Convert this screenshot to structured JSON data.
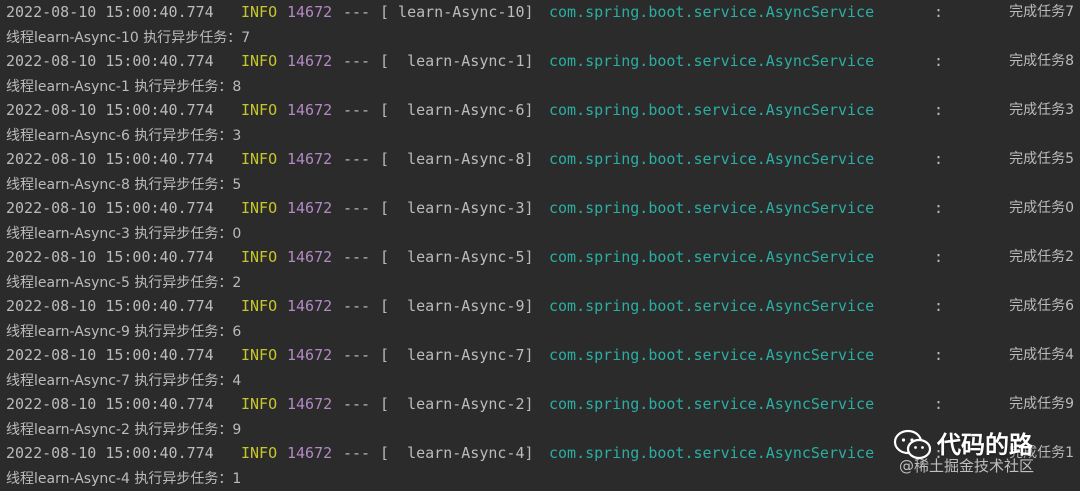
{
  "console": {
    "entries": [
      {
        "timestamp": "2022-08-10 15:00:40.774",
        "level": "INFO",
        "pid": "14672",
        "sep": "---",
        "thread": "[ learn-Async-10]",
        "logger": "com.spring.boot.service.AsyncService",
        "colon": ":",
        "message": "完成任务7",
        "output": "线程learn-Async-10 执行异步任务：7"
      },
      {
        "timestamp": "2022-08-10 15:00:40.774",
        "level": "INFO",
        "pid": "14672",
        "sep": "---",
        "thread": "[  learn-Async-1]",
        "logger": "com.spring.boot.service.AsyncService",
        "colon": ":",
        "message": "完成任务8",
        "output": "线程learn-Async-1 执行异步任务：8"
      },
      {
        "timestamp": "2022-08-10 15:00:40.774",
        "level": "INFO",
        "pid": "14672",
        "sep": "---",
        "thread": "[  learn-Async-6]",
        "logger": "com.spring.boot.service.AsyncService",
        "colon": ":",
        "message": "完成任务3",
        "output": "线程learn-Async-6 执行异步任务：3"
      },
      {
        "timestamp": "2022-08-10 15:00:40.774",
        "level": "INFO",
        "pid": "14672",
        "sep": "---",
        "thread": "[  learn-Async-8]",
        "logger": "com.spring.boot.service.AsyncService",
        "colon": ":",
        "message": "完成任务5",
        "output": "线程learn-Async-8 执行异步任务：5"
      },
      {
        "timestamp": "2022-08-10 15:00:40.774",
        "level": "INFO",
        "pid": "14672",
        "sep": "---",
        "thread": "[  learn-Async-3]",
        "logger": "com.spring.boot.service.AsyncService",
        "colon": ":",
        "message": "完成任务0",
        "output": "线程learn-Async-3 执行异步任务：0"
      },
      {
        "timestamp": "2022-08-10 15:00:40.774",
        "level": "INFO",
        "pid": "14672",
        "sep": "---",
        "thread": "[  learn-Async-5]",
        "logger": "com.spring.boot.service.AsyncService",
        "colon": ":",
        "message": "完成任务2",
        "output": "线程learn-Async-5 执行异步任务：2"
      },
      {
        "timestamp": "2022-08-10 15:00:40.774",
        "level": "INFO",
        "pid": "14672",
        "sep": "---",
        "thread": "[  learn-Async-9]",
        "logger": "com.spring.boot.service.AsyncService",
        "colon": ":",
        "message": "完成任务6",
        "output": "线程learn-Async-9 执行异步任务：6"
      },
      {
        "timestamp": "2022-08-10 15:00:40.774",
        "level": "INFO",
        "pid": "14672",
        "sep": "---",
        "thread": "[  learn-Async-7]",
        "logger": "com.spring.boot.service.AsyncService",
        "colon": ":",
        "message": "完成任务4",
        "output": "线程learn-Async-7 执行异步任务：4"
      },
      {
        "timestamp": "2022-08-10 15:00:40.774",
        "level": "INFO",
        "pid": "14672",
        "sep": "---",
        "thread": "[  learn-Async-2]",
        "logger": "com.spring.boot.service.AsyncService",
        "colon": ":",
        "message": "完成任务9",
        "output": "线程learn-Async-2 执行异步任务：9"
      },
      {
        "timestamp": "2022-08-10 15:00:40.774",
        "level": "INFO",
        "pid": "14672",
        "sep": "---",
        "thread": "[  learn-Async-4]",
        "logger": "com.spring.boot.service.AsyncService",
        "colon": ":",
        "message": "完成任务1",
        "output": "线程learn-Async-4 执行异步任务：1"
      }
    ]
  },
  "colors": {
    "background": "#2b2b2b",
    "text": "#bbbbbb",
    "level_info": "#c6c62c",
    "pid": "#b389c5",
    "logger": "#2aaea3"
  },
  "watermark": {
    "icon": "wechat-icon",
    "title": "代码的路",
    "subtitle": "@稀土掘金技术社区"
  }
}
